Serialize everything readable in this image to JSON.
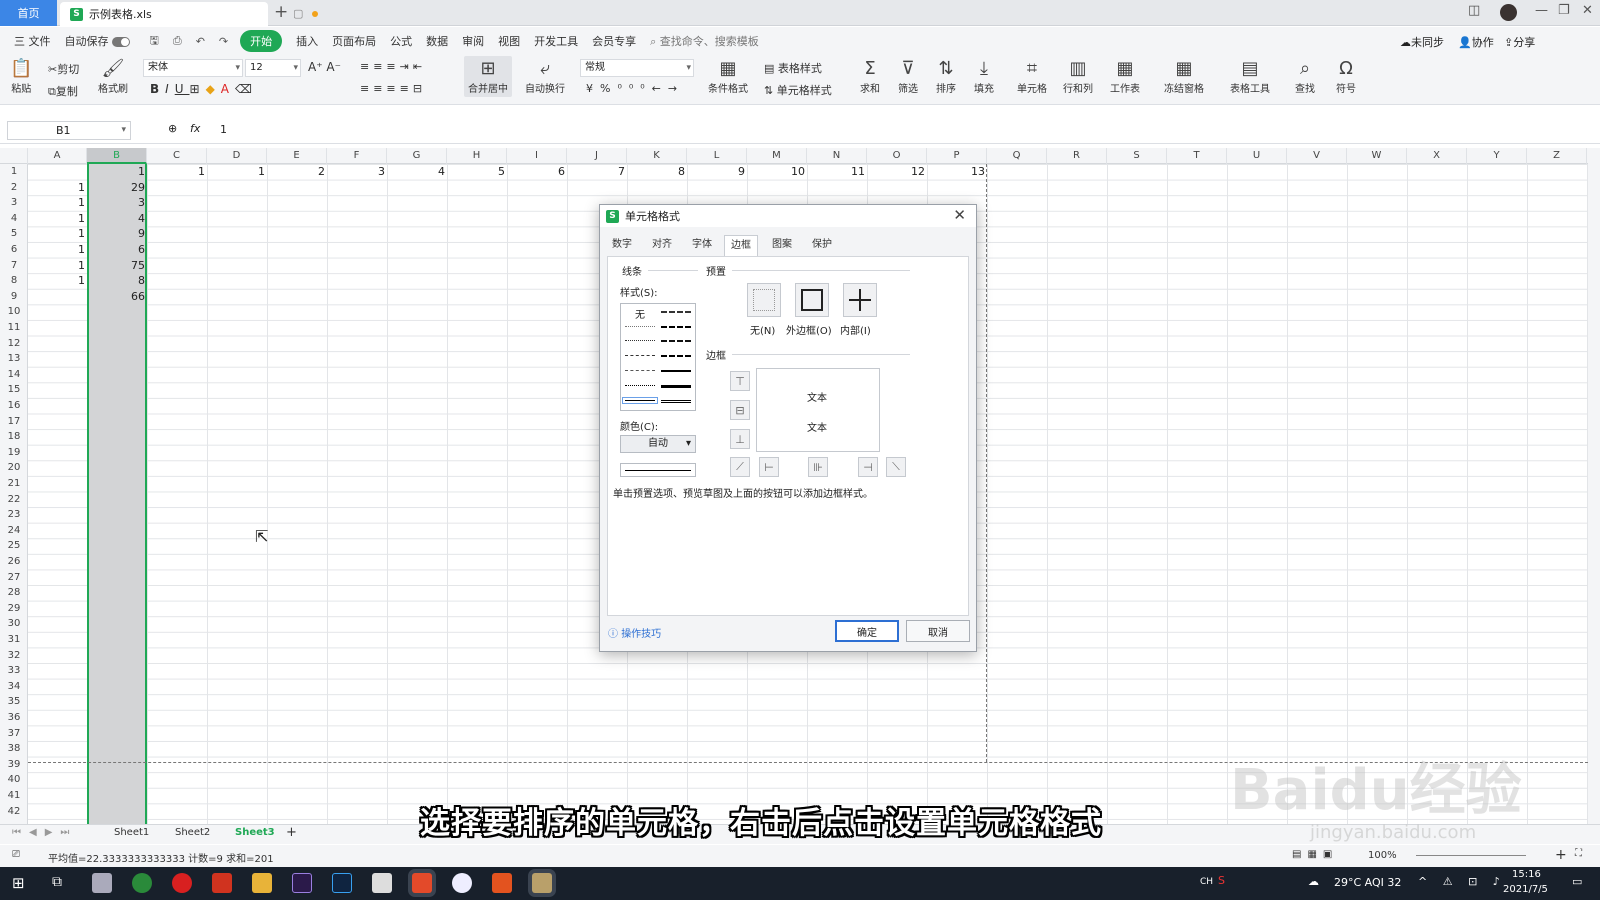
{
  "tabbar": {
    "home": "首页",
    "file_name": "示例表格.xls",
    "new_tab": "+"
  },
  "menu": {
    "file": "三 文件",
    "autosave": "自动保存",
    "tabs": [
      "开始",
      "插入",
      "页面布局",
      "公式",
      "数据",
      "审阅",
      "视图",
      "开发工具",
      "会员专享"
    ],
    "active_tab": "开始",
    "search": "查找命令、搜索模板",
    "sync": "未同步",
    "collab": "协作",
    "share": "分享"
  },
  "ribbon": {
    "paste": "粘贴",
    "cut": "剪切",
    "copy": "复制",
    "format_painter": "格式刷",
    "font": "宋体",
    "font_size": "12",
    "merge": "合并居中",
    "wrap": "自动换行",
    "number_format": "常规",
    "cond_format": "条件格式",
    "table_style": "表格样式",
    "cell_style": "单元格样式",
    "sum": "求和",
    "filter": "筛选",
    "sort": "排序",
    "fill": "填充",
    "cell": "单元格",
    "rowcol": "行和列",
    "sheet": "工作表",
    "freeze": "冻结窗格",
    "table_tools": "表格工具",
    "find": "查找",
    "symbol": "符号"
  },
  "formula_bar": {
    "name_box": "B1",
    "fx": "fx",
    "value": "1"
  },
  "columns": [
    "A",
    "B",
    "C",
    "D",
    "E",
    "F",
    "G",
    "H",
    "I",
    "J",
    "K",
    "L",
    "M",
    "N",
    "O",
    "P",
    "Q",
    "R",
    "S",
    "T",
    "U",
    "V",
    "W",
    "X",
    "Y",
    "Z"
  ],
  "selected_column": "B",
  "row_count": 42,
  "cells": {
    "col_a": [
      "",
      "1",
      "1",
      "1",
      "1",
      "1",
      "1",
      "1"
    ],
    "col_b": [
      "1",
      "29",
      "3",
      "4",
      "9",
      "6",
      "75",
      "8",
      "66"
    ],
    "row1_values": [
      "1",
      "1",
      "2",
      "3",
      "4",
      "5",
      "6",
      "7",
      "8",
      "9",
      "10",
      "11",
      "12",
      "13"
    ]
  },
  "sheets": [
    "Sheet1",
    "Sheet2",
    "Sheet3"
  ],
  "active_sheet": "Sheet3",
  "status": "平均值=22.3333333333333  计数=9  求和=201",
  "zoom": "100%",
  "dialog": {
    "title": "单元格格式",
    "tabs": [
      "数字",
      "对齐",
      "字体",
      "边框",
      "图案",
      "保护"
    ],
    "active_tab": "边框",
    "line_section": "线条",
    "style_label": "样式(S):",
    "style_none": "无",
    "color_label": "颜色(C):",
    "color_value": "自动",
    "preset_section": "预置",
    "preset_none": "无(N)",
    "preset_outline": "外边框(O)",
    "preset_inside": "内部(I)",
    "border_section": "边框",
    "preview_text": "文本",
    "hint": "单击预置选项、预览草图及上面的按钮可以添加边框样式。",
    "tips": "操作技巧",
    "ok": "确定",
    "cancel": "取消"
  },
  "caption": "选择要排序的单元格，右击后点击设置单元格格式",
  "watermark": {
    "main": "Baidu经验",
    "url": "jingyan.baidu.com"
  },
  "taskbar": {
    "ime": "CH",
    "weather": "29°C AQI 32",
    "time": "15:16",
    "date": "2021/7/5"
  },
  "colors": {
    "accent": "#1fa855",
    "home_tab": "#3c86e6",
    "taskbar": "#18202b"
  }
}
